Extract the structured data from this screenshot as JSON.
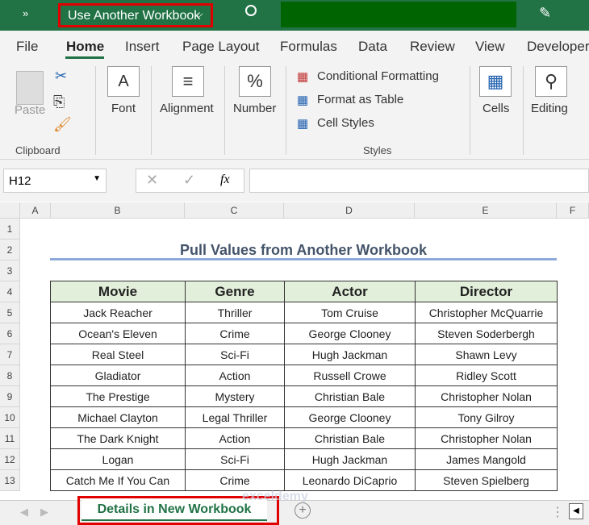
{
  "titlebar": {
    "more": "»",
    "workbook_name": "Use Another Workbook",
    "chevron": "⌵"
  },
  "ribbon_tabs": [
    "File",
    "Home",
    "Insert",
    "Page Layout",
    "Formulas",
    "Data",
    "Review",
    "View",
    "Developer"
  ],
  "ribbon": {
    "paste": "Paste",
    "font": "Font",
    "alignment": "Alignment",
    "number": "Number",
    "conditional_formatting": "Conditional Formatting",
    "format_as_table": "Format as Table",
    "cell_styles": "Cell Styles",
    "cells": "Cells",
    "editing": "Editing",
    "clipboard_group": "Clipboard",
    "styles_group": "Styles"
  },
  "formula_bar": {
    "name_box": "H12",
    "fx": "fx",
    "value": ""
  },
  "columns": [
    "A",
    "B",
    "C",
    "D",
    "E",
    "F"
  ],
  "rows": [
    "1",
    "2",
    "3",
    "4",
    "5",
    "6",
    "7",
    "8",
    "9",
    "10",
    "11",
    "12",
    "13"
  ],
  "sheet": {
    "title": "Pull Values from Another Workbook",
    "headers": [
      "Movie",
      "Genre",
      "Actor",
      "Director"
    ],
    "data": [
      [
        "Jack Reacher",
        "Thriller",
        "Tom Cruise",
        "Christopher McQuarrie"
      ],
      [
        "Ocean's Eleven",
        "Crime",
        "George Clooney",
        "Steven Soderbergh"
      ],
      [
        "Real Steel",
        "Sci-Fi",
        "Hugh Jackman",
        "Shawn Levy"
      ],
      [
        "Gladiator",
        "Action",
        "Russell Crowe",
        "Ridley Scott"
      ],
      [
        "The Prestige",
        "Mystery",
        "Christian Bale",
        "Christopher Nolan"
      ],
      [
        "Michael Clayton",
        "Legal Thriller",
        "George Clooney",
        "Tony Gilroy"
      ],
      [
        "The Dark Knight",
        "Action",
        "Christian Bale",
        "Christopher Nolan"
      ],
      [
        "Logan",
        "Sci-Fi",
        "Hugh Jackman",
        "James Mangold"
      ],
      [
        "Catch Me If You Can",
        "Crime",
        "Leonardo DiCaprio",
        "Steven Spielberg"
      ]
    ]
  },
  "sheet_tabs": {
    "active": "Details in New Workbook",
    "add": "+"
  },
  "watermark": "exceldemy EXCEL · DATA · BI",
  "colors": {
    "excel_green": "#217346",
    "header_fill": "#e2efda",
    "highlight": "#ff0000"
  }
}
